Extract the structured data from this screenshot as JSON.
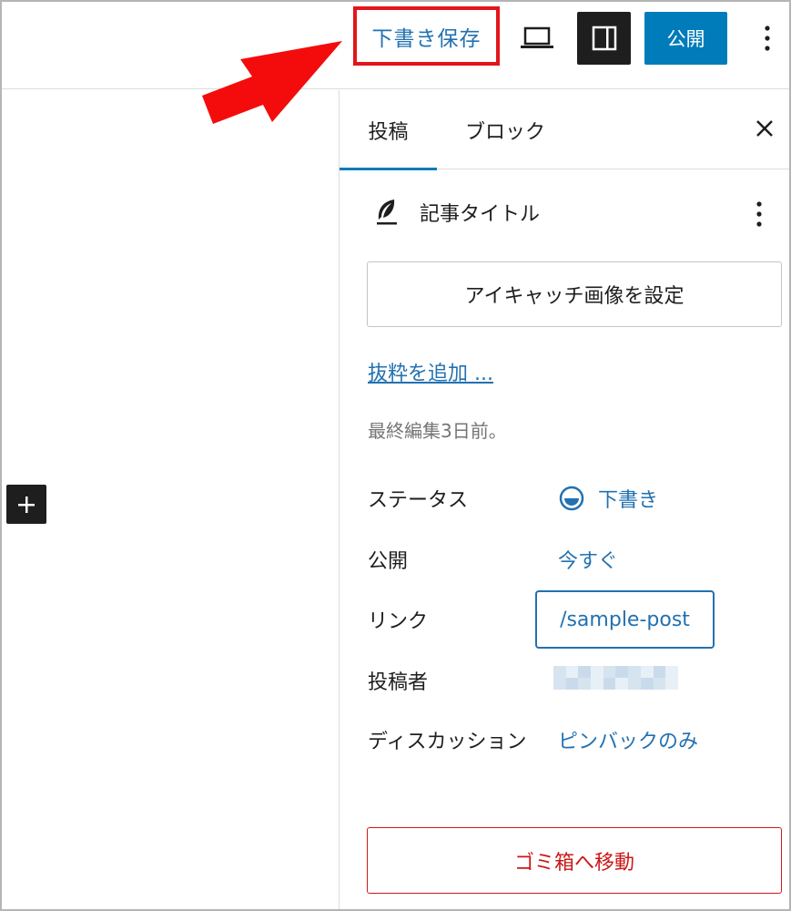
{
  "toolbar": {
    "save_draft_label": "下書き保存",
    "publish_label": "公開",
    "preview_icon": "laptop-icon",
    "settings_icon": "sidebar-panel-icon",
    "options_icon": "vertical-ellipsis-icon"
  },
  "sidebar": {
    "tabs": [
      {
        "label": "投稿",
        "active": true
      },
      {
        "label": "ブロック",
        "active": false
      }
    ],
    "close_icon": "close-icon",
    "post_type_label": "記事タイトル",
    "post_type_icon": "feather-icon",
    "featured_image_label": "アイキャッチ画像を設定",
    "excerpt_link": "抜粋を追加 ...",
    "last_edited": "最終編集3日前。",
    "rows": {
      "status": {
        "label": "ステータス",
        "value": "下書き"
      },
      "publish": {
        "label": "公開",
        "value": "今すぐ"
      },
      "link": {
        "label": "リンク",
        "value": "/sample-post"
      },
      "author": {
        "label": "投稿者",
        "value": ""
      },
      "discussion": {
        "label": "ディスカッション",
        "value": "ピンバックのみ"
      }
    },
    "trash_label": "ゴミ箱へ移動"
  },
  "colors": {
    "accent": "#007cba",
    "link": "#2271b1",
    "danger": "#cc1818",
    "highlight": "#e3151a"
  }
}
